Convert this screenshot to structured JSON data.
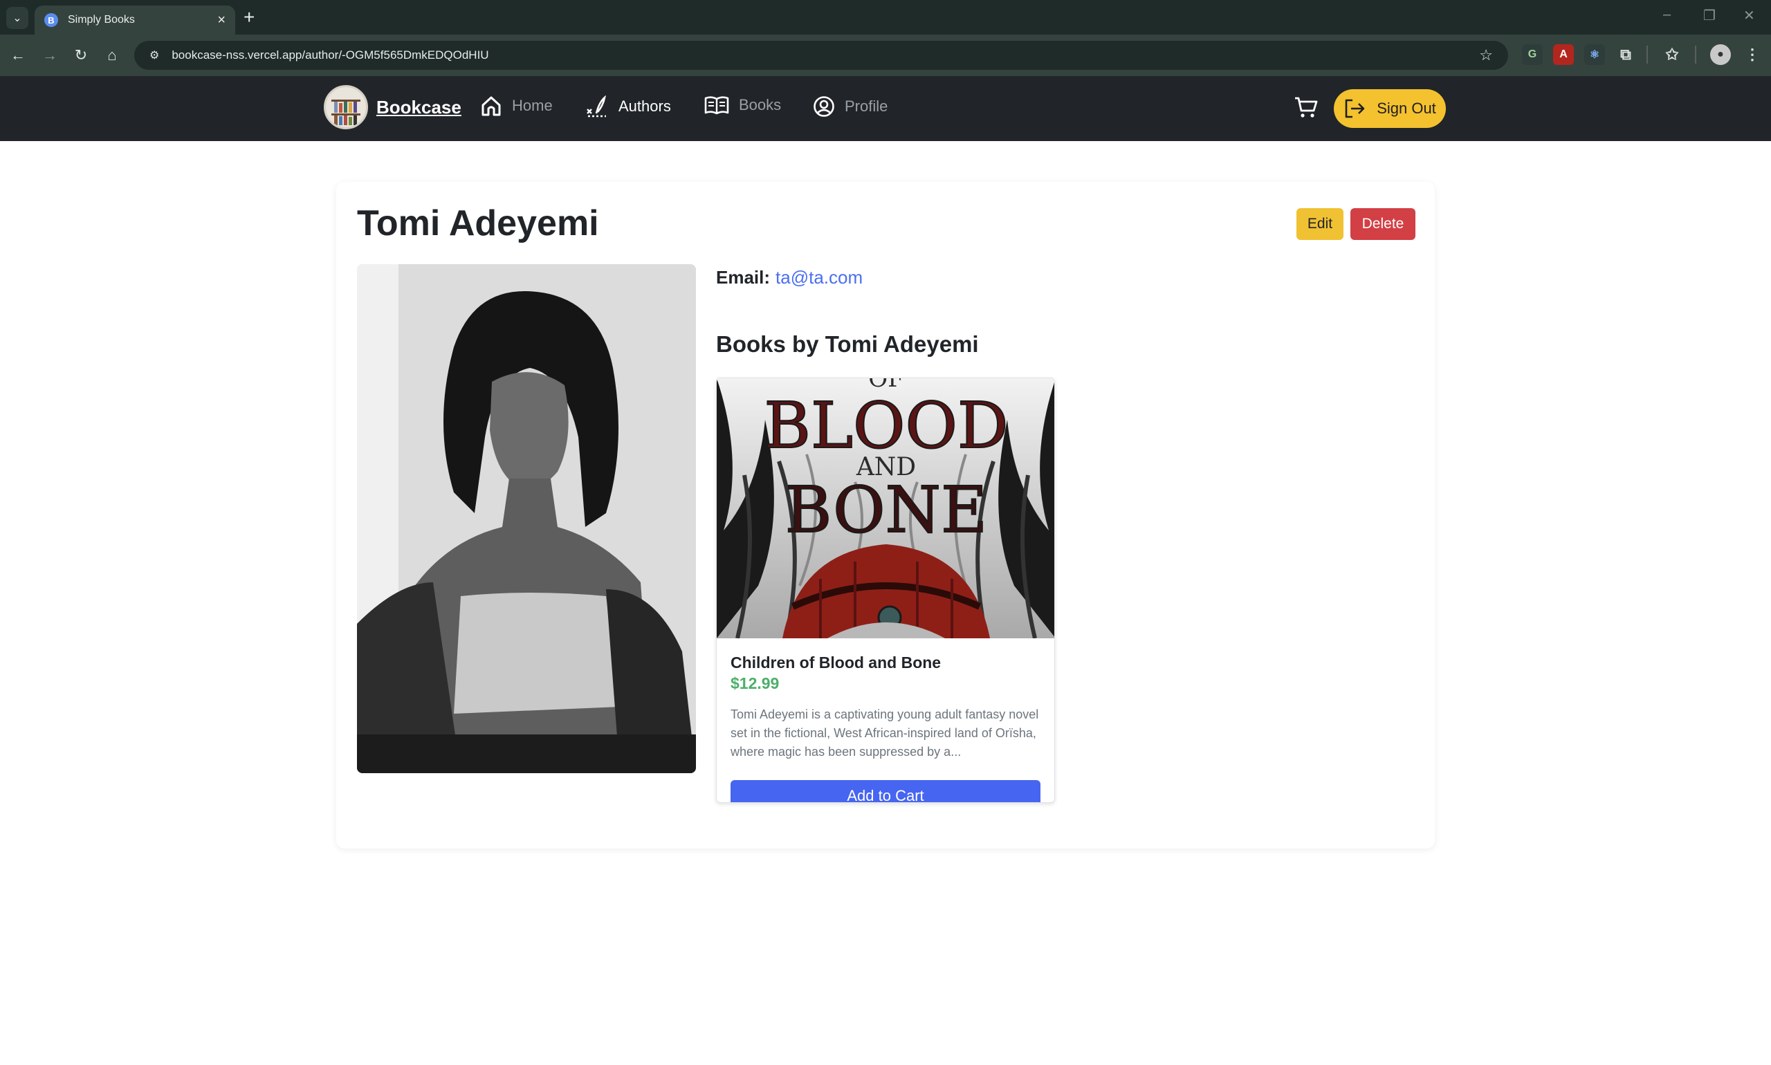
{
  "browser": {
    "tab_title": "Simply Books",
    "url": "bookcase-nss.vercel.app/author/-OGM5f565DmkEDQOdHIU"
  },
  "nav": {
    "brand": "Bookcase",
    "items": [
      {
        "label": "Home",
        "icon": "home-icon",
        "active": false
      },
      {
        "label": "Authors",
        "icon": "authors-icon",
        "active": true
      },
      {
        "label": "Books",
        "icon": "book-icon",
        "active": false
      },
      {
        "label": "Profile",
        "icon": "profile-icon",
        "active": false
      }
    ],
    "signout_label": "Sign Out"
  },
  "author": {
    "name": "Tomi Adeyemi",
    "email_label": "Email:",
    "email": "ta@ta.com",
    "edit_label": "Edit",
    "delete_label": "Delete",
    "books_heading": "Books by Tomi Adeyemi"
  },
  "books": [
    {
      "cover_text": [
        "OF",
        "BLOOD",
        "AND",
        "BONE"
      ],
      "title": "Children of Blood and Bone",
      "price": "$12.99",
      "description": "Tomi Adeyemi is a captivating young adult fantasy novel set in the fictional, West African-inspired land of Orïsha, where magic has been suppressed by a...",
      "add_to_cart_label": "Add to Cart"
    }
  ],
  "colors": {
    "navbar_bg": "#212529",
    "signout_bg": "#f4c12f",
    "edit_bg": "#f0c132",
    "delete_bg": "#d23f45",
    "link": "#4a6ff0",
    "price": "#4caf6a",
    "primary_button": "#4665f0"
  }
}
